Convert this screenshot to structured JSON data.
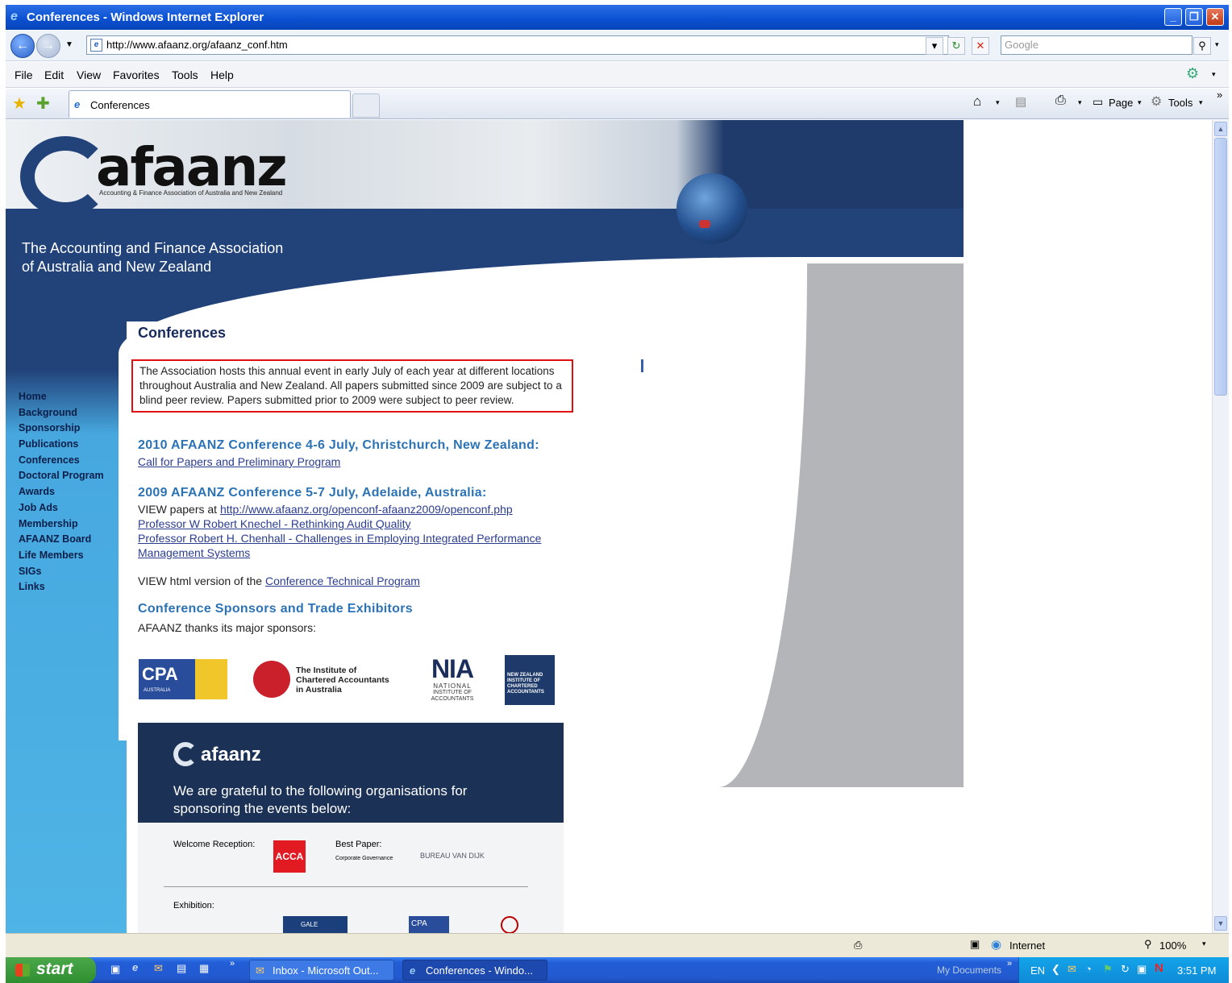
{
  "window": {
    "title": "Conferences - Windows Internet Explorer"
  },
  "address": {
    "url": "http://www.afaanz.org/afaanz_conf.htm",
    "search_placeholder": "Google"
  },
  "menu": [
    "File",
    "Edit",
    "View",
    "Favorites",
    "Tools",
    "Help"
  ],
  "tab": {
    "label": "Conferences"
  },
  "commandbar": {
    "page": "Page",
    "tools": "Tools"
  },
  "site": {
    "logo_text": "afaanz",
    "logo_subtitle": "Accounting & Finance Association of Australia and New Zealand",
    "association_line1": "The Accounting and Finance Association",
    "association_line2": "of Australia and New Zealand",
    "nav": [
      "Home",
      "Background",
      "Sponsorship",
      "Publications",
      "Conferences",
      "Doctoral Program",
      "Awards",
      "Job Ads",
      "Membership",
      "AFAANZ Board",
      "Life Members",
      "SIGs",
      "Links"
    ]
  },
  "content": {
    "title": "Conferences",
    "intro": "The Association hosts this annual event in early July of each year at different locations throughout Australia and New Zealand. All papers submitted since 2009 are subject to a blind peer review. Papers submitted prior to 2009 were subject to peer review.",
    "conf2010_heading": "2010 AFAANZ Conference 4-6 July, Christchurch, New Zealand:",
    "conf2010_link": "Call for Papers and Preliminary Program",
    "conf2009_heading": "2009 AFAANZ Conference 5-7 July, Adelaide, Australia:",
    "view_papers_prefix": "VIEW papers at ",
    "view_papers_link": "http://www.afaanz.org/openconf-afaanz2009/openconf.php",
    "knechel_link": "Professor W Robert Knechel - Rethinking Audit Quality",
    "chenhall_link_1": "Professor Robert H. Chenhall - Challenges in Employing Integrated Performance",
    "chenhall_link_2": "Management Systems",
    "view_html_prefix": "VIEW html version of the ",
    "tech_program_link": "Conference Technical Program",
    "sponsors_heading": "Conference Sponsors and Trade Exhibitors",
    "sponsors_thanks": "AFAANZ thanks its major sponsors:"
  },
  "sponsor_logos": {
    "cpa": "CPA",
    "cpa_sub": "AUSTRALIA",
    "icaa_line1": "The Institute of",
    "icaa_line2": "Chartered Accountants",
    "icaa_line3": "in Australia",
    "nia": "NIA",
    "nia_sub1": "NATIONAL",
    "nia_sub2": "INSTITUTE OF",
    "nia_sub3": "ACCOUNTANTS",
    "nzica": "NEW ZEALAND INSTITUTE OF CHARTERED ACCOUNTANTS"
  },
  "sponsor_box": {
    "logo": "afaanz",
    "grateful_line1": "We are grateful to the following organisations for",
    "grateful_line2": "sponsoring the events below:",
    "welcome_label": "Welcome Reception:",
    "acca": "ACCA",
    "best_paper_label": "Best Paper:",
    "best_paper_sub": "Corporate Governance",
    "bvd": "BUREAU VAN DIJK",
    "exhibition_label": "Exhibition:",
    "gale": "GALE",
    "cpa_small": "CPA"
  },
  "status": {
    "zone": "Internet",
    "zoom": "100%"
  },
  "taskbar": {
    "start": "start",
    "items": [
      "Inbox - Microsoft Out...",
      "Conferences - Windo..."
    ],
    "my_documents": "My Documents",
    "lang": "EN",
    "time": "3:51 PM"
  }
}
